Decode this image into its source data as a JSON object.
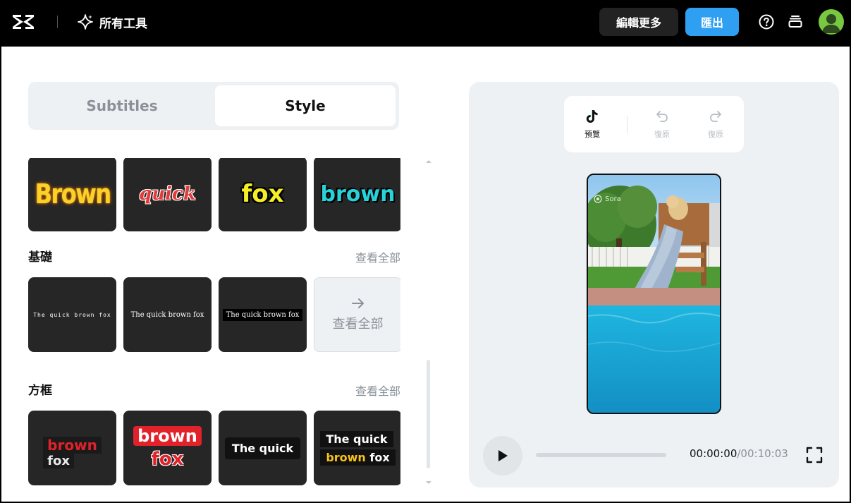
{
  "header": {
    "all_tools": "所有工具",
    "edit_more": "編輯更多",
    "export": "匯出"
  },
  "tabs": {
    "subtitles": "Subtitles",
    "style": "Style",
    "active": "Style"
  },
  "styles": {
    "row1": [
      "Brown",
      "quick",
      "fox",
      "brown"
    ],
    "basic": {
      "title": "基礎",
      "view_all": "查看全部",
      "samples": [
        "The quick brown fox",
        "The quick brown fox",
        "The quick brown fox"
      ],
      "view_all_tile": "查看全部"
    },
    "box": {
      "title": "方框",
      "view_all": "查看全部",
      "samples": [
        {
          "line1": "brown",
          "line2": "fox"
        },
        {
          "line1": "brown",
          "line2": "fox"
        },
        {
          "line1": "The quick"
        },
        {
          "line1": "The quick",
          "line2a": "brown",
          "line2b": "fox"
        }
      ]
    }
  },
  "preview": {
    "tiktok_label": "預覽",
    "undo_label": "復原",
    "redo_label": "復原",
    "watermark": "Sora",
    "time_current": "00:00:00",
    "time_duration": "/00:10:03",
    "progress": 0
  },
  "colors": {
    "accent": "#2f9ff2",
    "avatar": "#78c93f",
    "panel_bg": "#eef1f3"
  }
}
